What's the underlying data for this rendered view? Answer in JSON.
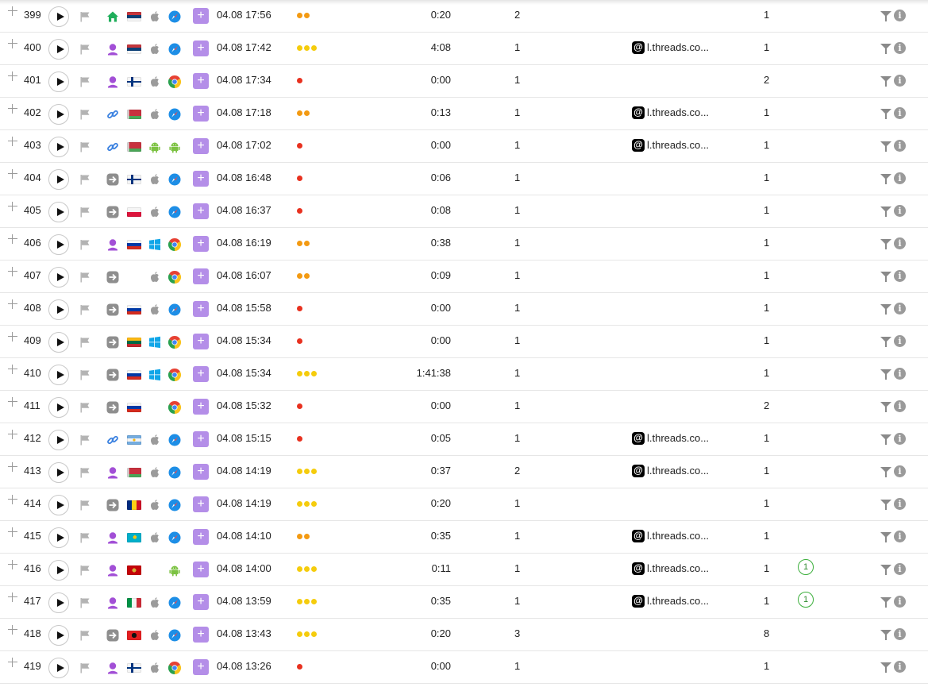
{
  "rows": [
    {
      "id": "399",
      "time": "04.08 17:56",
      "duration": "0:20",
      "pages": "2",
      "referrer": "",
      "visits": "1",
      "goals": "",
      "source": "home",
      "country": "rs",
      "os": "apple",
      "browser": "safari",
      "quality": 2
    },
    {
      "id": "400",
      "time": "04.08 17:42",
      "duration": "4:08",
      "pages": "1",
      "referrer": "l.threads.co...",
      "visits": "1",
      "goals": "",
      "source": "organic",
      "country": "rs",
      "os": "apple",
      "browser": "safari",
      "quality": 3
    },
    {
      "id": "401",
      "time": "04.08 17:34",
      "duration": "0:00",
      "pages": "1",
      "referrer": "",
      "visits": "2",
      "goals": "",
      "source": "organic",
      "country": "fi",
      "os": "apple",
      "browser": "chrome",
      "quality": 1
    },
    {
      "id": "402",
      "time": "04.08 17:18",
      "duration": "0:13",
      "pages": "1",
      "referrer": "l.threads.co...",
      "visits": "1",
      "goals": "",
      "source": "link",
      "country": "by",
      "os": "apple",
      "browser": "safari",
      "quality": 2
    },
    {
      "id": "403",
      "time": "04.08 17:02",
      "duration": "0:00",
      "pages": "1",
      "referrer": "l.threads.co...",
      "visits": "1",
      "goals": "",
      "source": "link",
      "country": "by",
      "os": "android",
      "browser": "android",
      "quality": 1
    },
    {
      "id": "404",
      "time": "04.08 16:48",
      "duration": "0:06",
      "pages": "1",
      "referrer": "",
      "visits": "1",
      "goals": "",
      "source": "direct",
      "country": "fi",
      "os": "apple",
      "browser": "safari",
      "quality": 1
    },
    {
      "id": "405",
      "time": "04.08 16:37",
      "duration": "0:08",
      "pages": "1",
      "referrer": "",
      "visits": "1",
      "goals": "",
      "source": "direct",
      "country": "pl",
      "os": "apple",
      "browser": "safari",
      "quality": 1
    },
    {
      "id": "406",
      "time": "04.08 16:19",
      "duration": "0:38",
      "pages": "1",
      "referrer": "",
      "visits": "1",
      "goals": "",
      "source": "organic",
      "country": "ru",
      "os": "windows",
      "browser": "chrome",
      "quality": 2
    },
    {
      "id": "407",
      "time": "04.08 16:07",
      "duration": "0:09",
      "pages": "1",
      "referrer": "",
      "visits": "1",
      "goals": "",
      "source": "direct",
      "country": "",
      "os": "apple",
      "browser": "chrome",
      "quality": 2
    },
    {
      "id": "408",
      "time": "04.08 15:58",
      "duration": "0:00",
      "pages": "1",
      "referrer": "",
      "visits": "1",
      "goals": "",
      "source": "direct",
      "country": "ru",
      "os": "apple",
      "browser": "safari",
      "quality": 1
    },
    {
      "id": "409",
      "time": "04.08 15:34",
      "duration": "0:00",
      "pages": "1",
      "referrer": "",
      "visits": "1",
      "goals": "",
      "source": "direct",
      "country": "lt",
      "os": "windows",
      "browser": "chrome",
      "quality": 1
    },
    {
      "id": "410",
      "time": "04.08 15:34",
      "duration": "1:41:38",
      "pages": "1",
      "referrer": "",
      "visits": "1",
      "goals": "",
      "source": "direct",
      "country": "ru",
      "os": "windows",
      "browser": "chrome",
      "quality": 3
    },
    {
      "id": "411",
      "time": "04.08 15:32",
      "duration": "0:00",
      "pages": "1",
      "referrer": "",
      "visits": "2",
      "goals": "",
      "source": "direct",
      "country": "ru",
      "os": "",
      "browser": "chrome",
      "quality": 1
    },
    {
      "id": "412",
      "time": "04.08 15:15",
      "duration": "0:05",
      "pages": "1",
      "referrer": "l.threads.co...",
      "visits": "1",
      "goals": "",
      "source": "link",
      "country": "ar",
      "os": "apple",
      "browser": "safari",
      "quality": 1
    },
    {
      "id": "413",
      "time": "04.08 14:19",
      "duration": "0:37",
      "pages": "2",
      "referrer": "l.threads.co...",
      "visits": "1",
      "goals": "",
      "source": "organic",
      "country": "by",
      "os": "apple",
      "browser": "safari",
      "quality": 3
    },
    {
      "id": "414",
      "time": "04.08 14:19",
      "duration": "0:20",
      "pages": "1",
      "referrer": "",
      "visits": "1",
      "goals": "",
      "source": "direct",
      "country": "ro",
      "os": "apple",
      "browser": "safari",
      "quality": 3
    },
    {
      "id": "415",
      "time": "04.08 14:10",
      "duration": "0:35",
      "pages": "1",
      "referrer": "l.threads.co...",
      "visits": "1",
      "goals": "",
      "source": "organic",
      "country": "kz",
      "os": "apple",
      "browser": "safari",
      "quality": 2
    },
    {
      "id": "416",
      "time": "04.08 14:00",
      "duration": "0:11",
      "pages": "1",
      "referrer": "l.threads.co...",
      "visits": "1",
      "goals": "1",
      "source": "organic",
      "country": "me",
      "os": "",
      "browser": "android",
      "quality": 3
    },
    {
      "id": "417",
      "time": "04.08 13:59",
      "duration": "0:35",
      "pages": "1",
      "referrer": "l.threads.co...",
      "visits": "1",
      "goals": "1",
      "source": "organic",
      "country": "it",
      "os": "apple",
      "browser": "safari",
      "quality": 3
    },
    {
      "id": "418",
      "time": "04.08 13:43",
      "duration": "0:20",
      "pages": "3",
      "referrer": "",
      "visits": "8",
      "goals": "",
      "source": "direct",
      "country": "al",
      "os": "apple",
      "browser": "safari",
      "quality": 3
    },
    {
      "id": "419",
      "time": "04.08 13:26",
      "duration": "0:00",
      "pages": "1",
      "referrer": "",
      "visits": "1",
      "goals": "",
      "source": "organic",
      "country": "fi",
      "os": "apple",
      "browser": "chrome",
      "quality": 1
    }
  ],
  "add_label": "+",
  "info_label": "i",
  "quality_colors": {
    "1": "#e8311f",
    "2": "#f39a12",
    "3": "#f5cc0c"
  }
}
